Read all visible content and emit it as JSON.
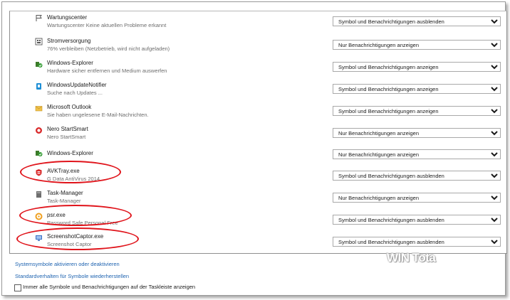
{
  "rows": [
    {
      "name": "Wartungscenter",
      "desc": "Wartungscenter  Keine aktuellen Probleme erkannt",
      "setting": "Symbol und Benachrichtigungen ausblenden",
      "icon": "flag-icon"
    },
    {
      "name": "Stromversorgung",
      "desc": "76% verbleiben (Netzbetrieb, wird nicht aufgeladen)",
      "setting": "Nur Benachrichtigungen anzeigen",
      "icon": "power-plug-icon"
    },
    {
      "name": "Windows-Explorer",
      "desc": "Hardware sicher entfernen und Medium auswerfen",
      "setting": "Symbol und Benachrichtigungen anzeigen",
      "icon": "usb-safely-remove-icon"
    },
    {
      "name": "WindowsUpdateNotifier",
      "desc": "Suche nach Updates ...",
      "setting": "Symbol und Benachrichtigungen anzeigen",
      "icon": "update-notifier-icon"
    },
    {
      "name": "Microsoft Outlook",
      "desc": "Sie haben ungelesene E-Mail-Nachrichten.",
      "setting": "Symbol und Benachrichtigungen anzeigen",
      "icon": "envelope-icon"
    },
    {
      "name": "Nero StartSmart",
      "desc": "Nero StartSmart",
      "setting": "Nur Benachrichtigungen anzeigen",
      "icon": "nero-icon"
    },
    {
      "name": "Windows-Explorer",
      "desc": "",
      "setting": "Nur Benachrichtigungen anzeigen",
      "icon": "usb-safely-remove-icon"
    },
    {
      "name": "AVKTray.exe",
      "desc": "G Data AntiVirus 2014",
      "setting": "Symbol und Benachrichtigungen ausblenden",
      "icon": "antivirus-icon"
    },
    {
      "name": "Task-Manager",
      "desc": "Task-Manager",
      "setting": "Nur Benachrichtigungen anzeigen",
      "icon": "task-manager-icon"
    },
    {
      "name": "psr.exe",
      "desc": "Password Safe Personal Free",
      "setting": "Symbol und Benachrichtigungen ausblenden",
      "icon": "password-safe-icon"
    },
    {
      "name": "ScreenshotCaptor.exe",
      "desc": "Screenshot Captor",
      "setting": "Symbol und Benachrichtigungen ausblenden",
      "icon": "screenshot-captor-icon"
    }
  ],
  "links": {
    "system_icons": "Systemsymbole aktivieren oder deaktivieren",
    "restore_default": "Standardverhalten für Symbole wiederherstellen"
  },
  "always_show_label": "Immer alle Symbole und Benachrichtigungen auf der Taskleiste anzeigen",
  "always_show_checked": false,
  "watermark": "WIN Tota",
  "colors": {
    "link": "#1e63b0",
    "highlight_ellipse": "#e0141b",
    "dropdown_border": "#a9a9a9"
  }
}
